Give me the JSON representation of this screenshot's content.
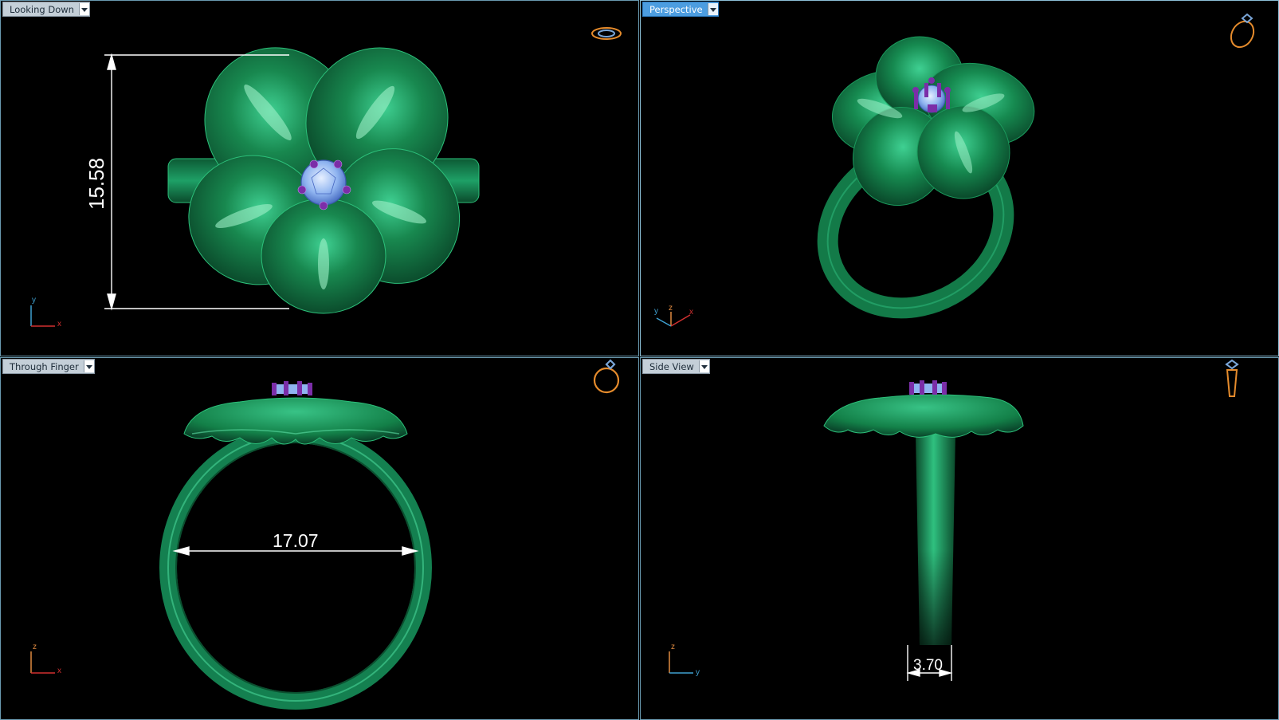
{
  "viewports": {
    "top_left": {
      "title": "Looking Down",
      "dimension": "15.58",
      "axes": [
        "y",
        "x"
      ]
    },
    "top_right": {
      "title": "Perspective",
      "axes": [
        "y",
        "z",
        "x"
      ]
    },
    "bottom_left": {
      "title": "Through Finger",
      "dimension": "17.07",
      "axes": [
        "z",
        "x"
      ]
    },
    "bottom_right": {
      "title": "Side View",
      "dimension": "3.70",
      "axes": [
        "z",
        "y"
      ]
    }
  },
  "colors": {
    "metal": "#147a4a",
    "gem": "#8fb4f0",
    "prong": "#7b2ea8",
    "axis_x": "#d23030",
    "axis_y": "#3fa0d0",
    "axis_z": "#e08a40",
    "widget": "#e58b2c"
  }
}
